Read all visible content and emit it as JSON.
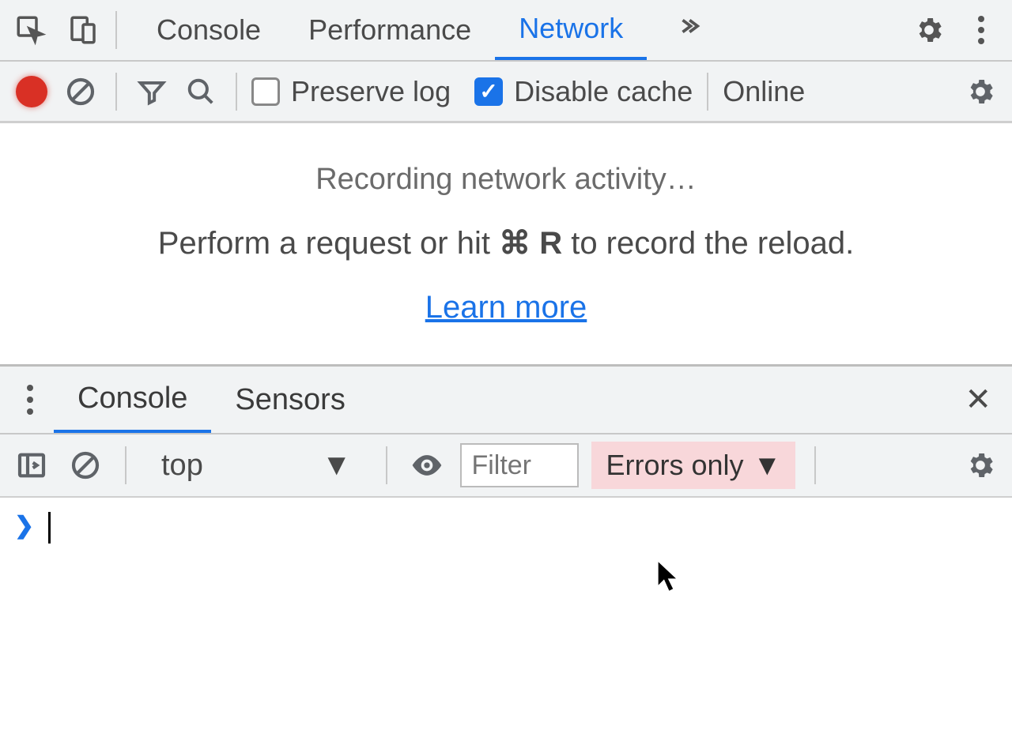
{
  "topTabs": {
    "tabs": [
      "Console",
      "Performance",
      "Network"
    ],
    "active": "Network"
  },
  "networkToolbar": {
    "preserveLog": {
      "label": "Preserve log",
      "checked": false
    },
    "disableCache": {
      "label": "Disable cache",
      "checked": true
    },
    "throttling": "Online"
  },
  "networkPanel": {
    "recordingTitle": "Recording network activity…",
    "hintPrefix": "Perform a request or hit ",
    "hintShortcut": "⌘ R",
    "hintSuffix": " to record the reload.",
    "learnMore": "Learn more"
  },
  "drawer": {
    "tabs": [
      "Console",
      "Sensors"
    ],
    "active": "Console"
  },
  "consoleToolbar": {
    "context": "top",
    "filterPlaceholder": "Filter",
    "levels": "Errors only"
  }
}
